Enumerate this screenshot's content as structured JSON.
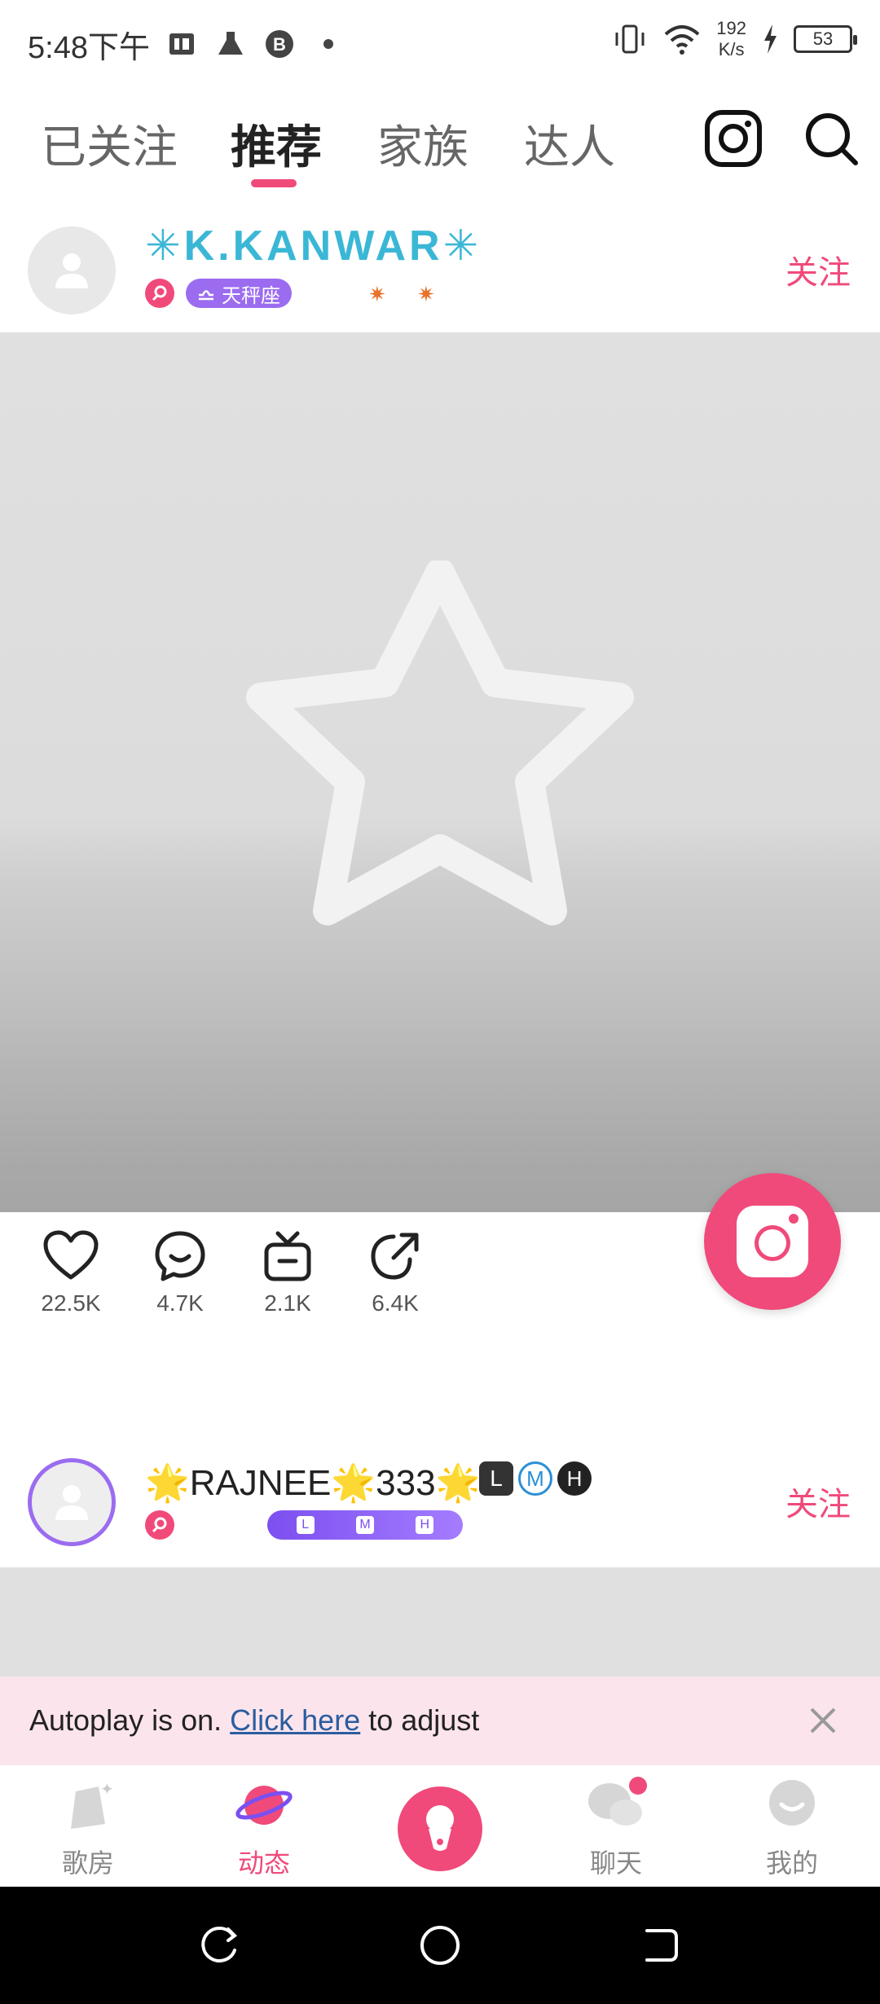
{
  "status_bar": {
    "time": "5:48下午",
    "net_speed_value": "192",
    "net_speed_unit": "K/s",
    "battery": "53"
  },
  "top_tabs": {
    "tabs": [
      {
        "label": "已关注",
        "active": false
      },
      {
        "label": "推荐",
        "active": true
      },
      {
        "label": "家族",
        "active": false
      },
      {
        "label": "达人",
        "active": false
      }
    ]
  },
  "posts": [
    {
      "username": "✳K.KANWAR✳",
      "zodiac": "天秤座",
      "follow_label": "关注",
      "likes": "22.5K",
      "comments": "4.7K",
      "gifts": "2.1K",
      "shares": "6.4K"
    },
    {
      "username": "🌟RAJNEE🌟333🌟",
      "level_tags": [
        "L",
        "M",
        "H"
      ],
      "follow_label": "关注"
    }
  ],
  "autoplay_banner": {
    "prefix": "Autoplay is on.",
    "link": "Click here",
    "suffix": "to adjust"
  },
  "bottom_nav": {
    "items": [
      {
        "label": "歌房",
        "active": false
      },
      {
        "label": "动态",
        "active": true
      },
      {
        "label": "聊天",
        "active": false
      },
      {
        "label": "我的",
        "active": false
      }
    ]
  },
  "colors": {
    "accent": "#f04a7a",
    "purple": "#9b6cf0",
    "banner_bg": "#fce4ec"
  }
}
